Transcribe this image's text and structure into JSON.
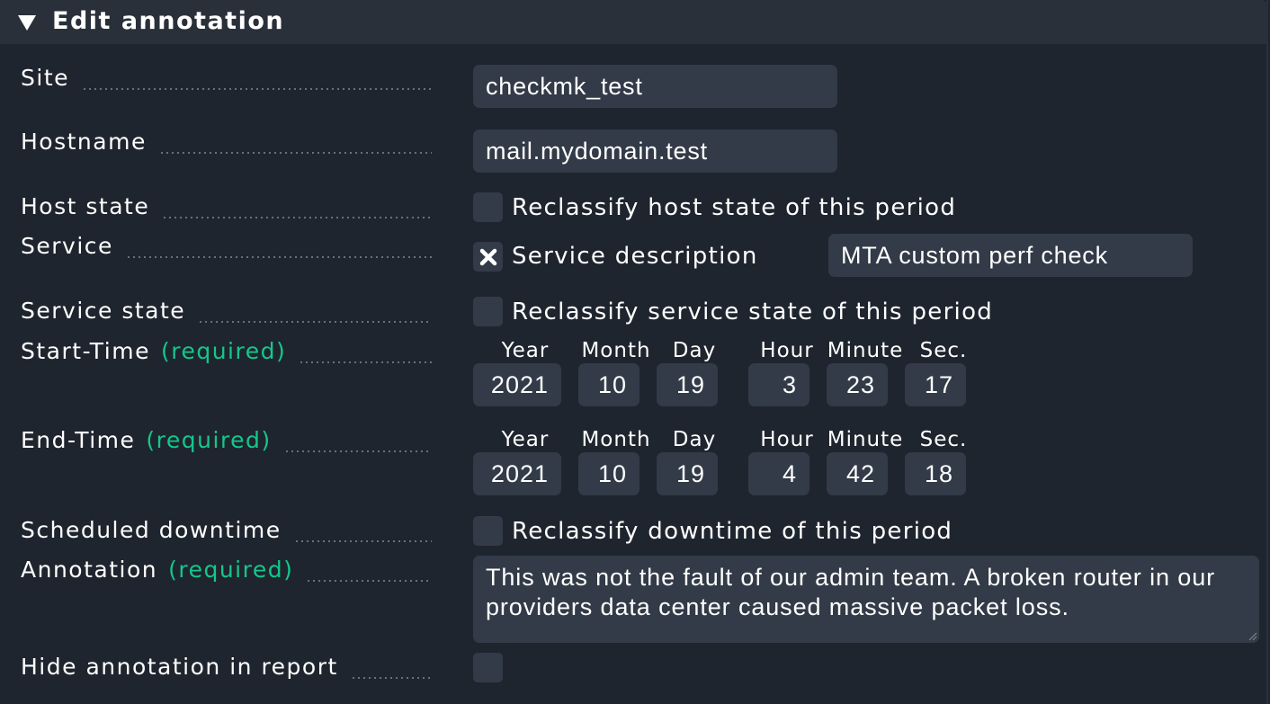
{
  "header": {
    "title": "Edit annotation"
  },
  "fields": {
    "site": {
      "label": "Site",
      "value": "checkmk_test"
    },
    "hostname": {
      "label": "Hostname",
      "value": "mail.mydomain.test"
    },
    "host_state": {
      "label": "Host state",
      "checkbox_label": "Reclassify host state of this period",
      "checked": false
    },
    "service": {
      "label": "Service",
      "checkbox_label": "Service description",
      "checked": true,
      "value": "MTA custom perf check"
    },
    "service_state": {
      "label": "Service state",
      "checkbox_label": "Reclassify service state of this period",
      "checked": false
    },
    "start_time": {
      "label": "Start-Time",
      "required": "(required)",
      "headers": {
        "year": "Year",
        "month": "Month",
        "day": "Day",
        "hour": "Hour",
        "minute": "Minute",
        "sec": "Sec."
      },
      "values": {
        "year": "2021",
        "month": "10",
        "day": "19",
        "hour": "3",
        "minute": "23",
        "sec": "17"
      }
    },
    "end_time": {
      "label": "End-Time",
      "required": "(required)",
      "headers": {
        "year": "Year",
        "month": "Month",
        "day": "Day",
        "hour": "Hour",
        "minute": "Minute",
        "sec": "Sec."
      },
      "values": {
        "year": "2021",
        "month": "10",
        "day": "19",
        "hour": "4",
        "minute": "42",
        "sec": "18"
      }
    },
    "scheduled_downtime": {
      "label": "Scheduled downtime",
      "checkbox_label": "Reclassify downtime of this period",
      "checked": false
    },
    "annotation": {
      "label": "Annotation",
      "required": "(required)",
      "value": "This was not the fault of our admin team. A broken router in our providers data center caused massive packet loss."
    },
    "hide_annotation": {
      "label": "Hide annotation in report",
      "checked": false
    }
  },
  "colors": {
    "background": "#1f252e",
    "input_bg": "#323b47",
    "required": "#14c78c",
    "header_bg": "#29303a"
  }
}
